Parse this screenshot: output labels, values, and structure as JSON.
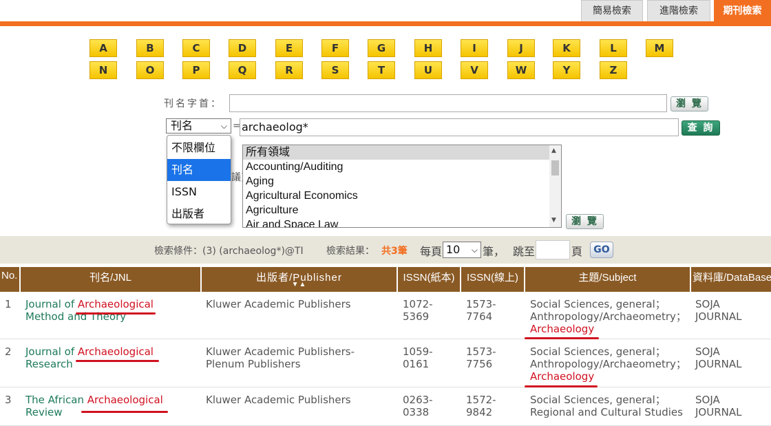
{
  "tabs": [
    {
      "label": "簡易檢索",
      "active": false
    },
    {
      "label": "進階檢索",
      "active": false
    },
    {
      "label": "期刊檢索",
      "active": true
    }
  ],
  "letters_row1": [
    "A",
    "B",
    "C",
    "D",
    "E",
    "F",
    "G",
    "H",
    "I",
    "J",
    "K",
    "L",
    "M"
  ],
  "letters_row2": [
    "N",
    "O",
    "P",
    "Q",
    "R",
    "S",
    "T",
    "U",
    "V",
    "W",
    "Y",
    "Z"
  ],
  "browse_prefix": {
    "label": "刊名字首：",
    "value": "",
    "button": "瀏 覽"
  },
  "query": {
    "field": "刊名",
    "equals": "=",
    "value": "archaeolog*",
    "button": "查 詢"
  },
  "field_options": [
    "不限欄位",
    "刊名",
    "ISSN",
    "出版者"
  ],
  "field_selected_index": 1,
  "subject_label_fragment": "議)",
  "subjects": [
    "所有領域",
    "Accounting/Auditing",
    "Aging",
    "Agricultural Economics",
    "Agriculture",
    "Air and Space Law"
  ],
  "subject_button": "瀏 覽",
  "status": {
    "conditions": "檢索條件：(3) (archaeolog*)@TI",
    "results_label": "檢索結果：",
    "results_value": "共3筆",
    "per_page_label": "每頁",
    "per_page_value": "10",
    "per_page_unit": "筆，",
    "jump_label": "跳至",
    "page_unit": "頁",
    "go_button": "GO"
  },
  "headers": [
    "No.",
    "刊名/JNL",
    "出版者/Publisher",
    "ISSN(紙本)",
    "ISSN(線上)",
    "主題/Subject",
    "資料庫/DataBase"
  ],
  "sort_arrows": "▼▲",
  "rows": [
    {
      "no": "1",
      "title_pre": "Journal of ",
      "title_hit": "Archaeological",
      "title_line2": "Method and Theory",
      "publisher": [
        "Kluwer Academic Publishers"
      ],
      "issn_print": [
        "1072-",
        "5369"
      ],
      "issn_online": [
        "1573-",
        "7764"
      ],
      "subject": [
        "Social Sciences, general；",
        "Anthropology/Archaeometry；"
      ],
      "subject_hit": "Archaeology",
      "database": [
        "SOJA",
        "JOURNAL"
      ]
    },
    {
      "no": "2",
      "title_pre": "Journal of ",
      "title_hit": "Archaeological",
      "title_line2": "Research",
      "publisher": [
        "Kluwer Academic Publishers-",
        "Plenum Publishers"
      ],
      "issn_print": [
        "1059-",
        "0161"
      ],
      "issn_online": [
        "1573-",
        "7756"
      ],
      "subject": [
        "Social Sciences, general；",
        "Anthropology/Archaeometry；"
      ],
      "subject_hit": "Archaeology",
      "database": [
        "SOJA",
        "JOURNAL"
      ]
    },
    {
      "no": "3",
      "title_pre": "The African ",
      "title_hit": "Archaeological",
      "title_line2": "Review",
      "publisher": [
        "Kluwer Academic Publishers"
      ],
      "issn_print": [
        "0263-",
        "0338"
      ],
      "issn_online": [
        "1572-",
        "9842"
      ],
      "subject": [
        "Social Sciences, general；",
        "Regional and Cultural Studies"
      ],
      "subject_hit": "",
      "database": [
        "SOJA",
        "JOURNAL"
      ]
    }
  ],
  "colors": {
    "accent": "#f26f21",
    "header_bg": "#8a5a25",
    "letter_bg": "#f5c400",
    "highlight": "#d0101f",
    "title": "#1d7a5a"
  }
}
